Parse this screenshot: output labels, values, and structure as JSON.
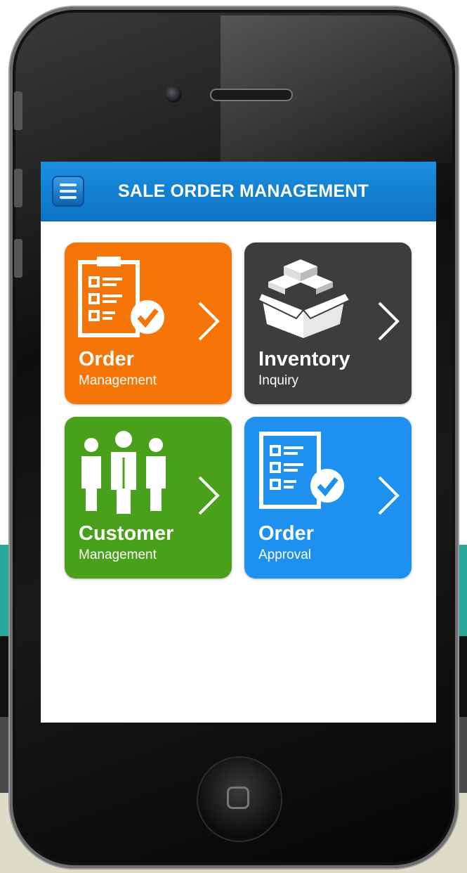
{
  "app": {
    "title": "SALE ORDER MANAGEMENT",
    "colors": {
      "appbar": "#1284d6",
      "order_management": "#f57509",
      "inventory_inquiry": "#3d3d3d",
      "customer_management": "#48a01b",
      "order_approval": "#1e90f0"
    }
  },
  "tiles": [
    {
      "title": "Order",
      "subtitle": "Management",
      "icon": "clipboard-check-icon"
    },
    {
      "title": "Inventory",
      "subtitle": "Inquiry",
      "icon": "boxes-icon"
    },
    {
      "title": "Customer",
      "subtitle": "Management",
      "icon": "people-icon"
    },
    {
      "title": "Order",
      "subtitle": "Approval",
      "icon": "checklist-approval-icon"
    }
  ]
}
